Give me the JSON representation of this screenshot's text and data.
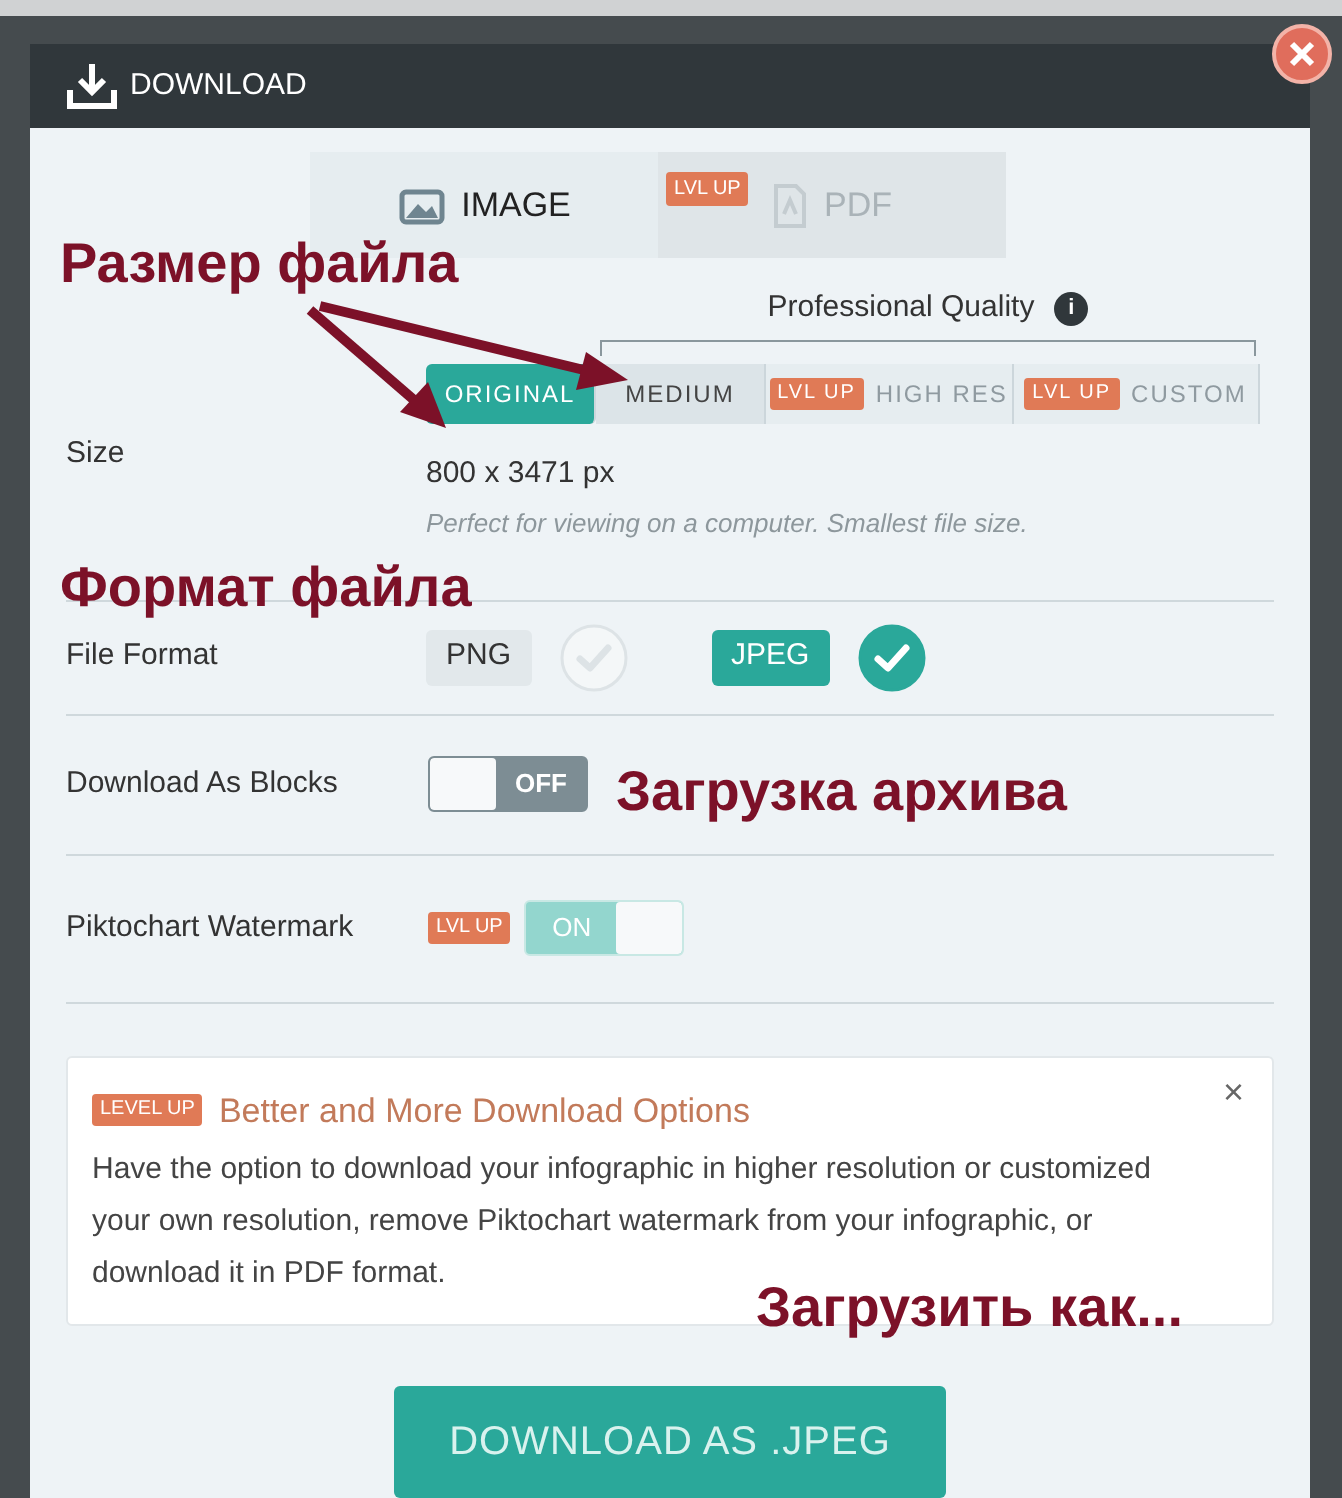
{
  "header": {
    "title": "DOWNLOAD"
  },
  "tabs": [
    {
      "label": "IMAGE",
      "selected": true,
      "kind": "image"
    },
    {
      "label": "PDF",
      "selected": false,
      "kind": "pdf",
      "badge": "LVL UP"
    }
  ],
  "size": {
    "label": "Size",
    "quality_label": "Professional Quality",
    "info_glyph": "i",
    "options": [
      {
        "label": "ORIGINAL",
        "selected": true
      },
      {
        "label": "MEDIUM",
        "selected": false
      },
      {
        "label": "HIGH RES",
        "selected": false,
        "badge": "LVL UP"
      },
      {
        "label": "CUSTOM",
        "selected": false,
        "badge": "LVL UP"
      }
    ],
    "dimensions": "800 x 3471 px",
    "description": "Perfect for viewing on a computer. Smallest file size."
  },
  "file_format": {
    "label": "File Format",
    "options": [
      {
        "label": "PNG",
        "selected": false
      },
      {
        "label": "JPEG",
        "selected": true
      }
    ]
  },
  "download_as_blocks": {
    "label": "Download As Blocks",
    "on": false,
    "state_text": "OFF"
  },
  "watermark": {
    "label": "Piktochart Watermark",
    "badge": "LVL UP",
    "on": true,
    "state_text": "ON"
  },
  "promo": {
    "badge": "LEVEL UP",
    "close_glyph": "×",
    "title": "Better and More Download Options",
    "body": "Have the option to download your infographic in higher resolution or customized your own resolution, remove Piktochart watermark from your infographic, or download it in PDF format."
  },
  "download_button": "DOWNLOAD AS .JPEG",
  "annotations": [
    {
      "text": "Размер файла",
      "kind": "size"
    },
    {
      "text": "Формат файла",
      "kind": "format"
    },
    {
      "text": "Загрузка архива",
      "kind": "blocks"
    },
    {
      "text": "Загрузить как...",
      "kind": "download"
    }
  ]
}
